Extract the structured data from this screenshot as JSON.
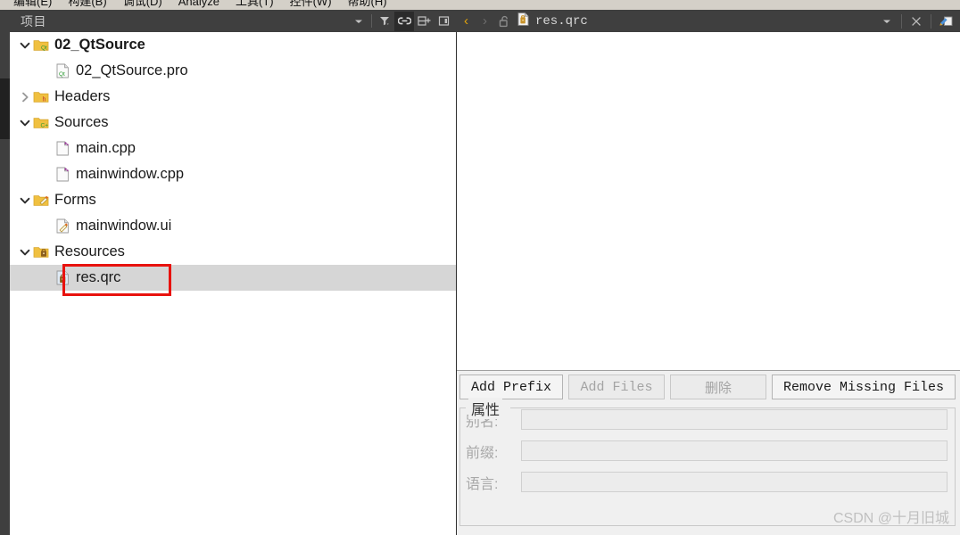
{
  "menubar": {
    "items": [
      {
        "label": "编辑(E)"
      },
      {
        "label": "构建(B)"
      },
      {
        "label": "调试(D)"
      },
      {
        "label": "Analyze"
      },
      {
        "label": "工具(T)"
      },
      {
        "label": "控件(W)"
      },
      {
        "label": "帮助(H)"
      }
    ]
  },
  "sidebar_dock": {
    "title": "项目",
    "tools": [
      {
        "name": "chevron-down-icon",
        "glyph": "▾"
      },
      {
        "name": "filter-icon",
        "glyph": "filter"
      },
      {
        "name": "link-icon",
        "glyph": "link"
      },
      {
        "name": "split-add-icon",
        "glyph": "split"
      },
      {
        "name": "collapse-icon",
        "glyph": "collapse"
      }
    ]
  },
  "tree": {
    "nodes": [
      {
        "label": "02_QtSource",
        "indent": 0,
        "twisty": "expanded",
        "icon": "qt-project-folder-icon",
        "bold": true,
        "selected": false
      },
      {
        "label": "02_QtSource.pro",
        "indent": 1,
        "twisty": "none",
        "icon": "qt-pro-file-icon",
        "bold": false,
        "selected": false
      },
      {
        "label": "Headers",
        "indent": 0,
        "twisty": "collapsed",
        "icon": "headers-folder-icon",
        "bold": false,
        "selected": false
      },
      {
        "label": "Sources",
        "indent": 0,
        "twisty": "expanded",
        "icon": "sources-folder-icon",
        "bold": false,
        "selected": false
      },
      {
        "label": "main.cpp",
        "indent": 1,
        "twisty": "none",
        "icon": "cpp-file-icon",
        "bold": false,
        "selected": false
      },
      {
        "label": "mainwindow.cpp",
        "indent": 1,
        "twisty": "none",
        "icon": "cpp-file-icon",
        "bold": false,
        "selected": false
      },
      {
        "label": "Forms",
        "indent": 0,
        "twisty": "expanded",
        "icon": "forms-folder-icon",
        "bold": false,
        "selected": false
      },
      {
        "label": "mainwindow.ui",
        "indent": 1,
        "twisty": "none",
        "icon": "ui-file-icon",
        "bold": false,
        "selected": false
      },
      {
        "label": "Resources",
        "indent": 0,
        "twisty": "expanded",
        "icon": "resources-folder-icon",
        "bold": false,
        "selected": false
      },
      {
        "label": "res.qrc",
        "indent": 1,
        "twisty": "none",
        "icon": "qrc-file-icon",
        "bold": false,
        "selected": true
      }
    ],
    "highlighted_node": "res.qrc"
  },
  "editor_toolbar": {
    "back_label": "‹",
    "forward_label": "›",
    "lock_icon": "unlock-icon",
    "document_name": "res.qrc",
    "document_icon": "qrc-file-icon",
    "dropdown_glyph": "▾",
    "close_glyph": "✕",
    "split_icon": "split-editor-icon"
  },
  "qrc_editor": {
    "buttons": [
      {
        "label": "Add Prefix",
        "enabled": true,
        "style": "mono"
      },
      {
        "label": "Add Files",
        "enabled": false,
        "style": "mono"
      },
      {
        "label": "删除",
        "enabled": false,
        "style": "cn"
      },
      {
        "label": "Remove Missing Files",
        "enabled": true,
        "style": "mono"
      }
    ],
    "properties": {
      "title": "属性",
      "fields": [
        {
          "label": "别名:",
          "value": "",
          "enabled": false
        },
        {
          "label": "前缀:",
          "value": "",
          "enabled": false
        },
        {
          "label": "语言:",
          "value": "",
          "enabled": false
        }
      ]
    }
  },
  "watermark": {
    "text": "CSDN @十月旧城"
  },
  "colors": {
    "dock_background": "#3f3f3f",
    "menubar_background": "#d4d0c8",
    "selection": "#d6d6d6",
    "annotation": "#e8120e",
    "accent_yellow": "#e5a50a",
    "panel_background": "#f0f0f0"
  }
}
